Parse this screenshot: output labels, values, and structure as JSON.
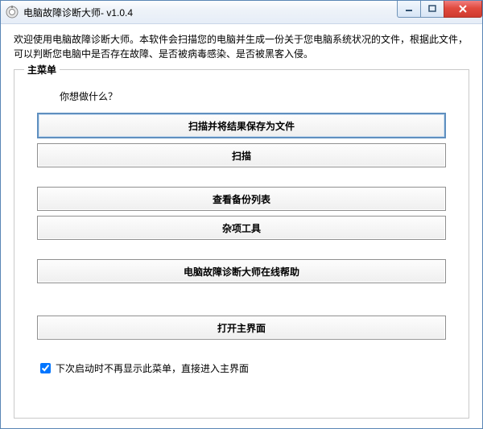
{
  "window": {
    "title": "电脑故障诊断大师- v1.0.4"
  },
  "intro": "欢迎使用电脑故障诊断大师。本软件会扫描您的电脑并生成一份关于您电脑系统状况的文件，根据此文件，可以判断您电脑中是否存在故障、是否被病毒感染、是否被黑客入侵。",
  "menu": {
    "legend": "主菜单",
    "prompt": "你想做什么？",
    "buttons": {
      "scan_save": "扫描并将结果保存为文件",
      "scan": "扫描",
      "view_backup": "查看备份列表",
      "misc_tools": "杂项工具",
      "online_help": "电脑故障诊断大师在线帮助",
      "open_main": "打开主界面"
    },
    "checkbox_label": "下次启动时不再显示此菜单，直接进入主界面",
    "checkbox_checked": true
  }
}
